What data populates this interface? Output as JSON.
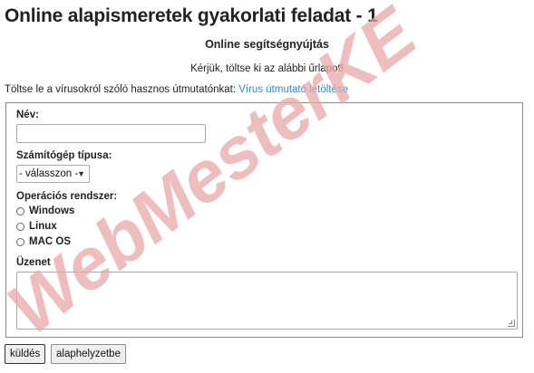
{
  "header": {
    "title": "Online alapismeretek gyakorlati feladat - 1",
    "subtitle": "Online segítségnyújtás",
    "intro": "Kérjük, töltse ki az alábbi űrlapot!"
  },
  "guide": {
    "text": "Töltse le a vírusokról szóló hasznos útmutatónkat: ",
    "link_label": "Vírus útmutató letöltése",
    "link_color": "#2a8ad8"
  },
  "form": {
    "name_label": "Név:",
    "name_value": "",
    "computer_type_label": "Számítógép típusa:",
    "computer_type_selected": "- válasszon -",
    "os_label": "Operációs rendszer:",
    "os_options": [
      "Windows",
      "Linux",
      "MAC OS"
    ],
    "message_label": "Üzenet",
    "message_value": ""
  },
  "buttons": {
    "submit_label": "küldés",
    "reset_label": "alaphelyzetbe"
  },
  "watermark": {
    "text": "WebMesterKE",
    "color": "#e8a8a8"
  }
}
